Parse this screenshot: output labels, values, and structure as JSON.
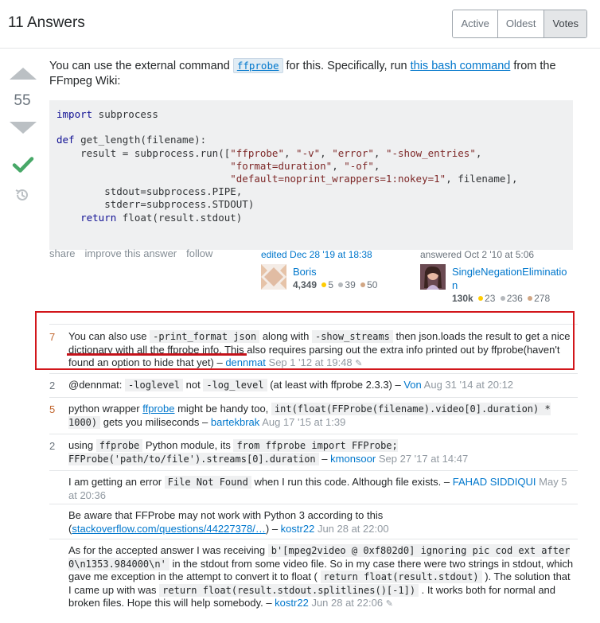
{
  "header": {
    "title": "11 Answers",
    "sort_tabs": [
      {
        "label": "Active"
      },
      {
        "label": "Oldest"
      },
      {
        "label": "Votes",
        "active": true
      }
    ]
  },
  "answer": {
    "score": "55",
    "intro_before": "You can use the external command ",
    "intro_code": "ffprobe",
    "intro_mid": " for this. Specifically, run ",
    "intro_link": "this bash command",
    "intro_after": " from the FFmpeg Wiki:",
    "code": {
      "l1_kw": "import",
      "l1_rest": " subprocess",
      "l3_kw": "def",
      "l3_rest": " get_length(filename):",
      "l4_a": "    result = subprocess.run([",
      "l4_s1": "\"ffprobe\"",
      "l4_b": ", ",
      "l4_s2": "\"-v\"",
      "l4_c": ", ",
      "l4_s3": "\"error\"",
      "l4_d": ", ",
      "l4_s4": "\"-show_entries\"",
      "l4_e": ",",
      "l5_a": "                             ",
      "l5_s1": "\"format=duration\"",
      "l5_b": ", ",
      "l5_s2": "\"-of\"",
      "l5_c": ",",
      "l6_a": "                             ",
      "l6_s1": "\"default=noprint_wrappers=1:nokey=1\"",
      "l6_b": ", filename],",
      "l7": "        stdout=subprocess.PIPE,",
      "l8": "        stderr=subprocess.STDOUT)",
      "l9_a": "    ",
      "l9_kw": "return",
      "l9_b": " float(result.stdout)"
    },
    "menu": {
      "share": "share",
      "improve": "improve this answer",
      "follow": "follow"
    },
    "editor": {
      "action": "edited Dec 28 '19 at 18:38",
      "name": "Boris",
      "rep": "4,349",
      "gold": "5",
      "silver": "39",
      "bronze": "50"
    },
    "author": {
      "action": "answered Oct 2 '10 at 5:06",
      "name_line1": "SingleNegationEliminatio",
      "name_line2": "n",
      "rep": "130k",
      "gold": "23",
      "silver": "236",
      "bronze": "278"
    },
    "colors": {
      "gold": "#ffcc01",
      "silver": "#b4b8bc",
      "bronze": "#d1a684",
      "accent": "#0077cc",
      "highlight": "#d2161b"
    }
  },
  "comments": [
    {
      "score": "7",
      "t1": "You can also use ",
      "code1": "-print_format json",
      "t2": " along with ",
      "code2": "-show_streams",
      "t3": " then json.loads the result to get a nice dictionary with all the ffprobe info. This also requires parsing out the extra info printed out by ffprobe(haven't found an option to hide that yet) – ",
      "user": "dennmat",
      "date": "Sep 1 '12 at 19:48"
    },
    {
      "score": "2",
      "t1": "@dennmat: ",
      "code1": "-loglevel",
      "t2": " not ",
      "code2": "-log_level",
      "t3": " (at least with ffprobe 2.3.3) – ",
      "user": "Von",
      "date": "Aug 31 '14 at 20:12"
    },
    {
      "score": "5",
      "t1": "python wrapper ",
      "link1": "ffprobe",
      "t2": " might be handy too, ",
      "code1": "int(float(FFProbe(filename).video[0].duration) * 1000)",
      "t3": " gets you miliseconds – ",
      "user": "bartekbrak",
      "date": "Aug 17 '15 at 1:39"
    },
    {
      "score": "2",
      "t1": "using ",
      "code1": "ffprobe",
      "t2": " Python module, its ",
      "code2": "from ffprobe import FFProbe; FFProbe('path/to/file').streams[0].duration",
      "t3": " – ",
      "user": "kmonsoor",
      "date": "Sep 27 '17 at 14:47"
    },
    {
      "score": "",
      "t1": "I am getting an error ",
      "code1": "File Not Found",
      "t2": " when I run this code. Although file exists. – ",
      "user": "FAHAD SIDDIQUI",
      "date": "May 5 at 20:36"
    },
    {
      "score": "",
      "t1": "Be aware that FFProbe may not work with Python 3 according to this (",
      "link1": "stackoverflow.com/questions/44227378/…",
      "t2": ") – ",
      "user": "kostr22",
      "date": "Jun 28 at 22:00"
    },
    {
      "score": "",
      "t1": "As for the accepted answer I was receiving ",
      "code1": "b'[mpeg2video @ 0xf802d0] ignoring pic cod ext after 0\\n1353.984000\\n'",
      "t2": " in the stdout from some video file. So in my case there were two strings in stdout, which gave me exception in the attempt to convert it to float ( ",
      "code2": "return float(result.stdout)",
      "t3": " ). The solution that I came up with was ",
      "code3": "return float(result.stdout.splitlines()[-1])",
      "t4": " . It works both for normal and broken files. Hope this will help somebody. – ",
      "user": "kostr22",
      "date": "Jun 28 at 22:06"
    }
  ]
}
